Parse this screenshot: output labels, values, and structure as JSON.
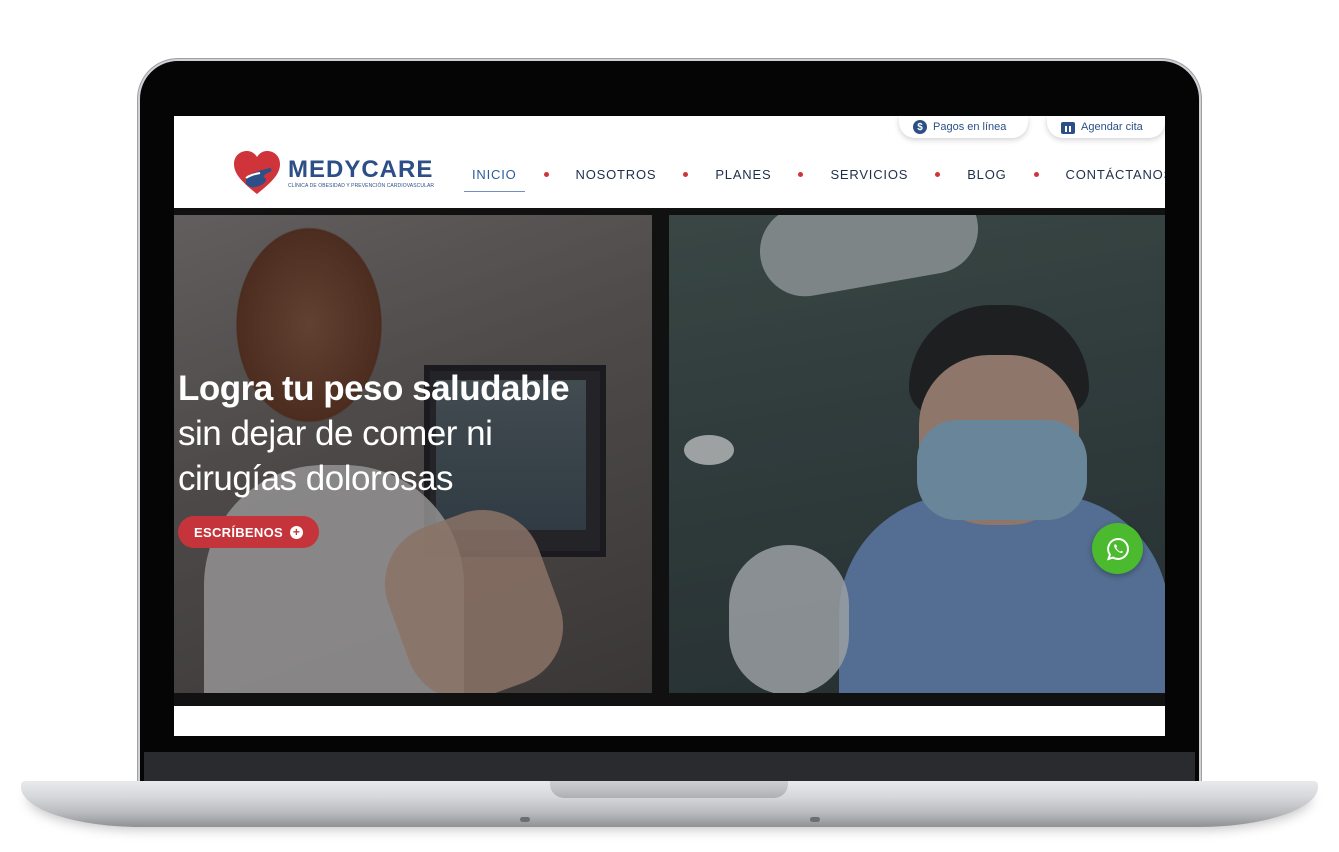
{
  "top_links": {
    "payments_label": "Pagos en línea",
    "payments_icon": "dollar-coin-icon",
    "appointment_label": "Agendar cita",
    "appointment_icon": "calendar-icon"
  },
  "brand": {
    "name": "MEDYCARE",
    "tagline": "CLÍNICA DE OBESIDAD Y PREVENCIÓN CARDIOVASCULAR",
    "primary_color": "#2b4f86",
    "accent_color": "#d0343b"
  },
  "nav": {
    "items": [
      {
        "label": "INICIO",
        "active": true
      },
      {
        "label": "NOSOTROS",
        "active": false
      },
      {
        "label": "PLANES",
        "active": false
      },
      {
        "label": "SERVICIOS",
        "active": false
      },
      {
        "label": "BLOG",
        "active": false
      },
      {
        "label": "CONTÁCTANOS",
        "active": false
      }
    ]
  },
  "hero": {
    "headline_bold": "Logra tu peso saludable",
    "headline_line2": "sin dejar de comer ni",
    "headline_line3": "cirugías dolorosas",
    "cta_label": "ESCRÍBENOS",
    "cta_icon": "plus-circle-icon",
    "cta_color": "#c5343b"
  },
  "whatsapp": {
    "icon": "whatsapp-icon",
    "color": "#4bba2e"
  }
}
